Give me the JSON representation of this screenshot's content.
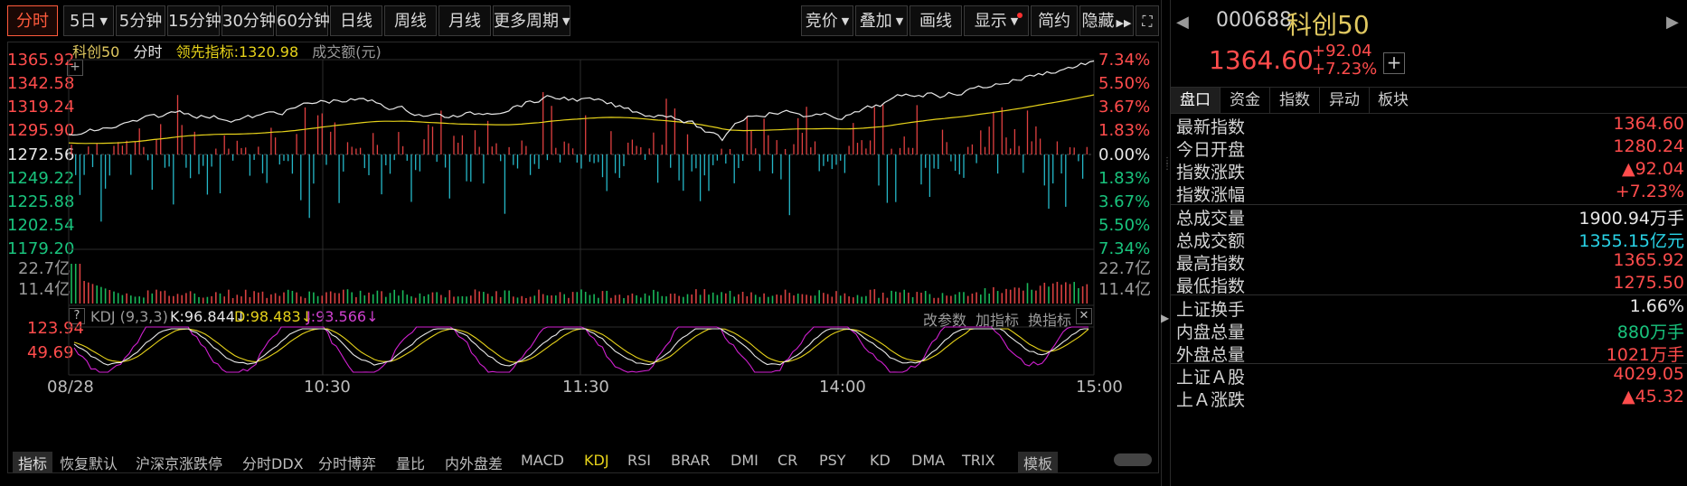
{
  "toolbar": {
    "periods": [
      "分时",
      "5日",
      "5分钟",
      "15分钟",
      "30分钟",
      "60分钟",
      "日线",
      "周线",
      "月线",
      "更多周期"
    ],
    "active_period": "分时",
    "right_buttons": [
      "竞价",
      "叠加",
      "画线",
      "显示",
      "简约",
      "隐藏"
    ]
  },
  "header": {
    "name": "科创50",
    "mode": "分时",
    "lead_label": "领先指标:1320.98",
    "amount_label": "成交额(元)"
  },
  "y_left": [
    "1365.92",
    "1342.58",
    "1319.24",
    "1295.90",
    "1272.56",
    "1249.22",
    "1225.88",
    "1202.54",
    "1179.20"
  ],
  "y_right": [
    "7.34%",
    "5.50%",
    "3.67%",
    "1.83%",
    "0.00%",
    "1.83%",
    "3.67%",
    "5.50%",
    "7.34%"
  ],
  "volume_axis": {
    "top": "22.7亿",
    "mid": "11.4亿"
  },
  "kdj": {
    "question": "?",
    "name": "KDJ (9,3,3)",
    "k": "K:96.844↓",
    "d": "D:98.483↓",
    "j": "J:93.566↓",
    "actions": [
      "改参数",
      "加指标",
      "换指标"
    ],
    "axis": [
      "123.94",
      "49.69"
    ]
  },
  "x_labels": [
    "08/28",
    "10:30",
    "11:30",
    "14:00",
    "15:00"
  ],
  "bottom_tabs": [
    "指标",
    "恢复默认",
    "沪深京涨跌停",
    "分时DDX",
    "分时博弈",
    "量比",
    "内外盘差",
    "MACD",
    "KDJ",
    "RSI",
    "BRAR",
    "DMI",
    "CR",
    "PSY",
    "KD",
    "DMA",
    "TRIX",
    "模板"
  ],
  "panel": {
    "code": "000688",
    "name": "科创50",
    "price": "1364.60",
    "change": "+92.04",
    "change_pct": "+7.23%",
    "tabs": [
      "盘口",
      "资金",
      "指数",
      "异动",
      "板块"
    ],
    "rows": [
      {
        "k": "最新指数",
        "v": "1364.60",
        "c": "red"
      },
      {
        "k": "今日开盘",
        "v": "1280.24",
        "c": "red"
      },
      {
        "k": "指数涨跌",
        "v": "▲92.04",
        "c": "red"
      },
      {
        "k": "指数涨幅",
        "v": "+7.23%",
        "c": "red"
      },
      {
        "k": "总成交量",
        "v": "1900.94万手",
        "c": "white"
      },
      {
        "k": "总成交额",
        "v": "1355.15亿元",
        "c": "cyan"
      },
      {
        "k": "最高指数",
        "v": "1365.92",
        "c": "red"
      },
      {
        "k": "最低指数",
        "v": "1275.50",
        "c": "red"
      },
      {
        "k": "上证换手",
        "v": "1.66%",
        "c": "white"
      },
      {
        "k": "内盘总量",
        "v": "880万手",
        "c": "green"
      },
      {
        "k": "外盘总量",
        "v": "1021万手",
        "c": "red"
      },
      {
        "k": "上证Ａ股",
        "v": "4029.05",
        "c": "red"
      },
      {
        "k": "上Ａ涨跌",
        "v": "▲45.32",
        "c": "red"
      }
    ]
  },
  "colors": {
    "up": "#ff4c4c",
    "down": "#19c37d",
    "accent": "#ff5a3c",
    "line_price": "#e8e8e8",
    "line_avg": "#e6d21a",
    "kdj_j": "#d020d0",
    "bar_down": "#25b8c8"
  }
}
